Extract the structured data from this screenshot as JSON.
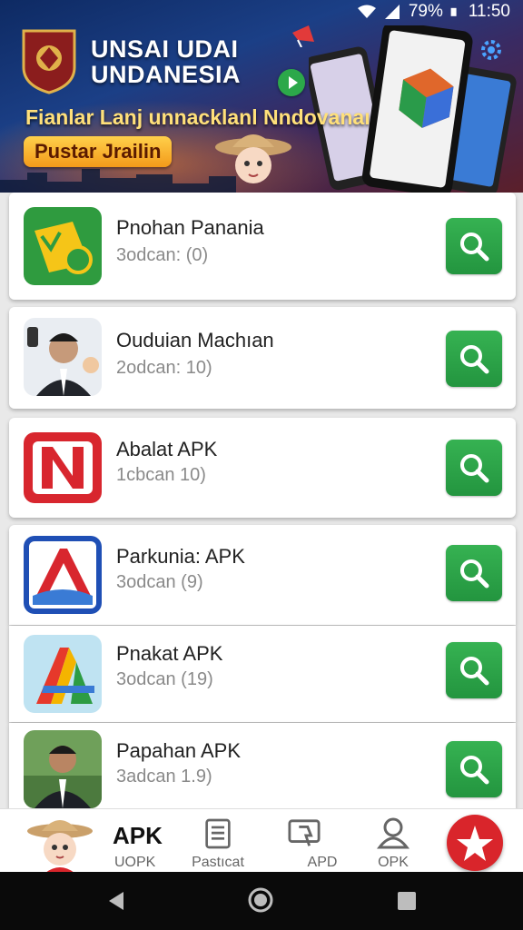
{
  "status_bar": {
    "battery": "79%",
    "time": "11:50"
  },
  "banner": {
    "title_line1": "UNSAI UDAI",
    "title_line2": "UNDANESIA",
    "subtitle": "Fianlar Lanj unnacklanl Nndovanaı",
    "pill": "Pustar Jrailin",
    "icons": [
      "crest-icon",
      "play-icon",
      "gear-icon",
      "megaphone-icon"
    ]
  },
  "apps": [
    {
      "name": "Pnohan Panania",
      "meta": "3odcan: (0)",
      "icon": "folder-app-icon"
    },
    {
      "name": "Ouduian Machıan",
      "meta": "2odcan: 10)",
      "icon": "portrait-app-icon"
    },
    {
      "name": "Abalat APK",
      "meta": "1cbcan 10)",
      "icon": "n-logo-icon"
    },
    {
      "name": "Parkunia: APK",
      "meta": "3odcan (9)",
      "icon": "a-logo-icon"
    },
    {
      "name": "Pnakat APK",
      "meta": "3odcan (19)",
      "icon": "rainbow-a-icon"
    },
    {
      "name": "Papahan APK",
      "meta": "3adcan 1.9)",
      "icon": "portrait-app-icon"
    }
  ],
  "bottom_nav": {
    "apk_title": "APK",
    "apk_sub": "UOPK",
    "items": [
      {
        "label": "Pastıcat",
        "icon": "document-icon"
      },
      {
        "label": "APD",
        "icon": "download-icon"
      },
      {
        "label": "OPK",
        "icon": "person-icon"
      }
    ]
  },
  "colors": {
    "accent": "#2ca84a",
    "fab": "#d9252b",
    "banner": "#1b3f86"
  }
}
